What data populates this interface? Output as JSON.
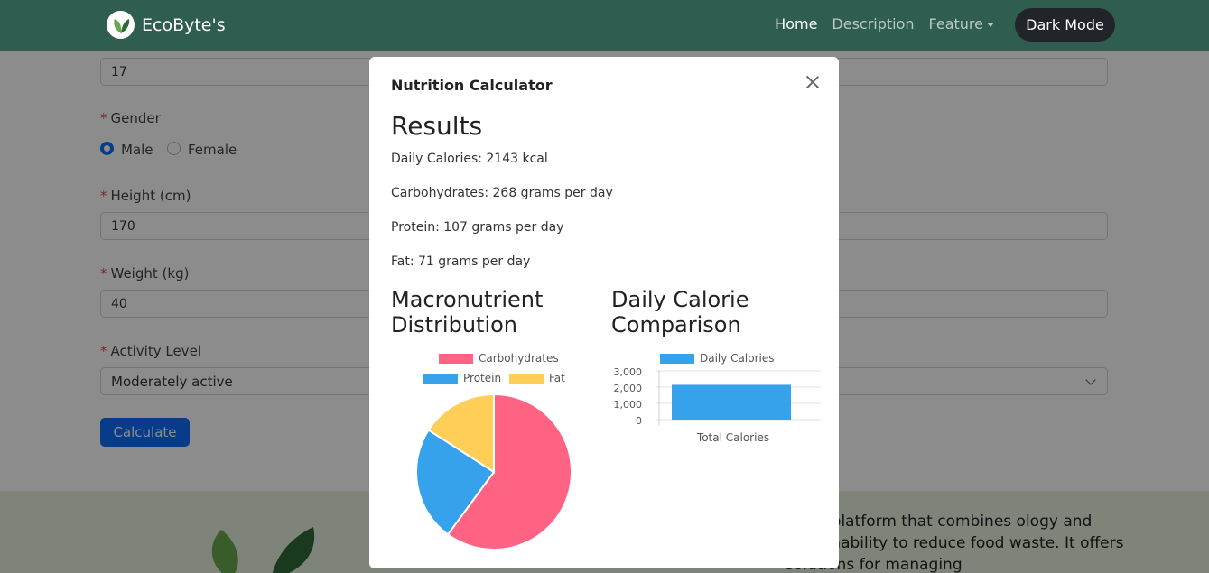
{
  "navbar": {
    "brand": "EcoByte's",
    "links": [
      "Home",
      "Description",
      "Feature"
    ],
    "dark_mode": "Dark Mode"
  },
  "form": {
    "age_value": "17",
    "gender_label": "Gender",
    "gender_options": [
      "Male",
      "Female"
    ],
    "height_label": "Height (cm)",
    "height_value": "170",
    "weight_label": "Weight (kg)",
    "weight_value": "40",
    "activity_label": "Activity Level",
    "activity_value": "Moderately active",
    "calculate": "Calculate"
  },
  "footer": {
    "text": "e is a platform that combines ology and sustainability to reduce food waste. It offers solutions for managing"
  },
  "modal": {
    "title": "Nutrition Calculator",
    "results_heading": "Results",
    "lines": [
      "Daily Calories: 2143 kcal",
      "Carbohydrates: 268 grams per day",
      "Protein: 107 grams per day",
      "Fat: 71 grams per day"
    ],
    "chart1_title": "Macronutrient Distribution",
    "chart2_title": "Daily Calorie Comparison"
  },
  "chart_data": [
    {
      "type": "pie",
      "categories": [
        "Carbohydrates",
        "Protein",
        "Fat"
      ],
      "values": [
        268,
        107,
        71
      ],
      "colors": [
        "#ff6384",
        "#36a2eb",
        "#ffce56"
      ],
      "legend": "top"
    },
    {
      "type": "bar",
      "categories": [
        "Total Calories"
      ],
      "series": [
        {
          "name": "Daily Calories",
          "values": [
            2143
          ]
        }
      ],
      "ylim": [
        0,
        3000
      ],
      "yticks": [
        "3,000",
        "2,000",
        "1,000",
        "0"
      ],
      "color": "#36a2eb",
      "legend": "top",
      "grid": true
    }
  ]
}
